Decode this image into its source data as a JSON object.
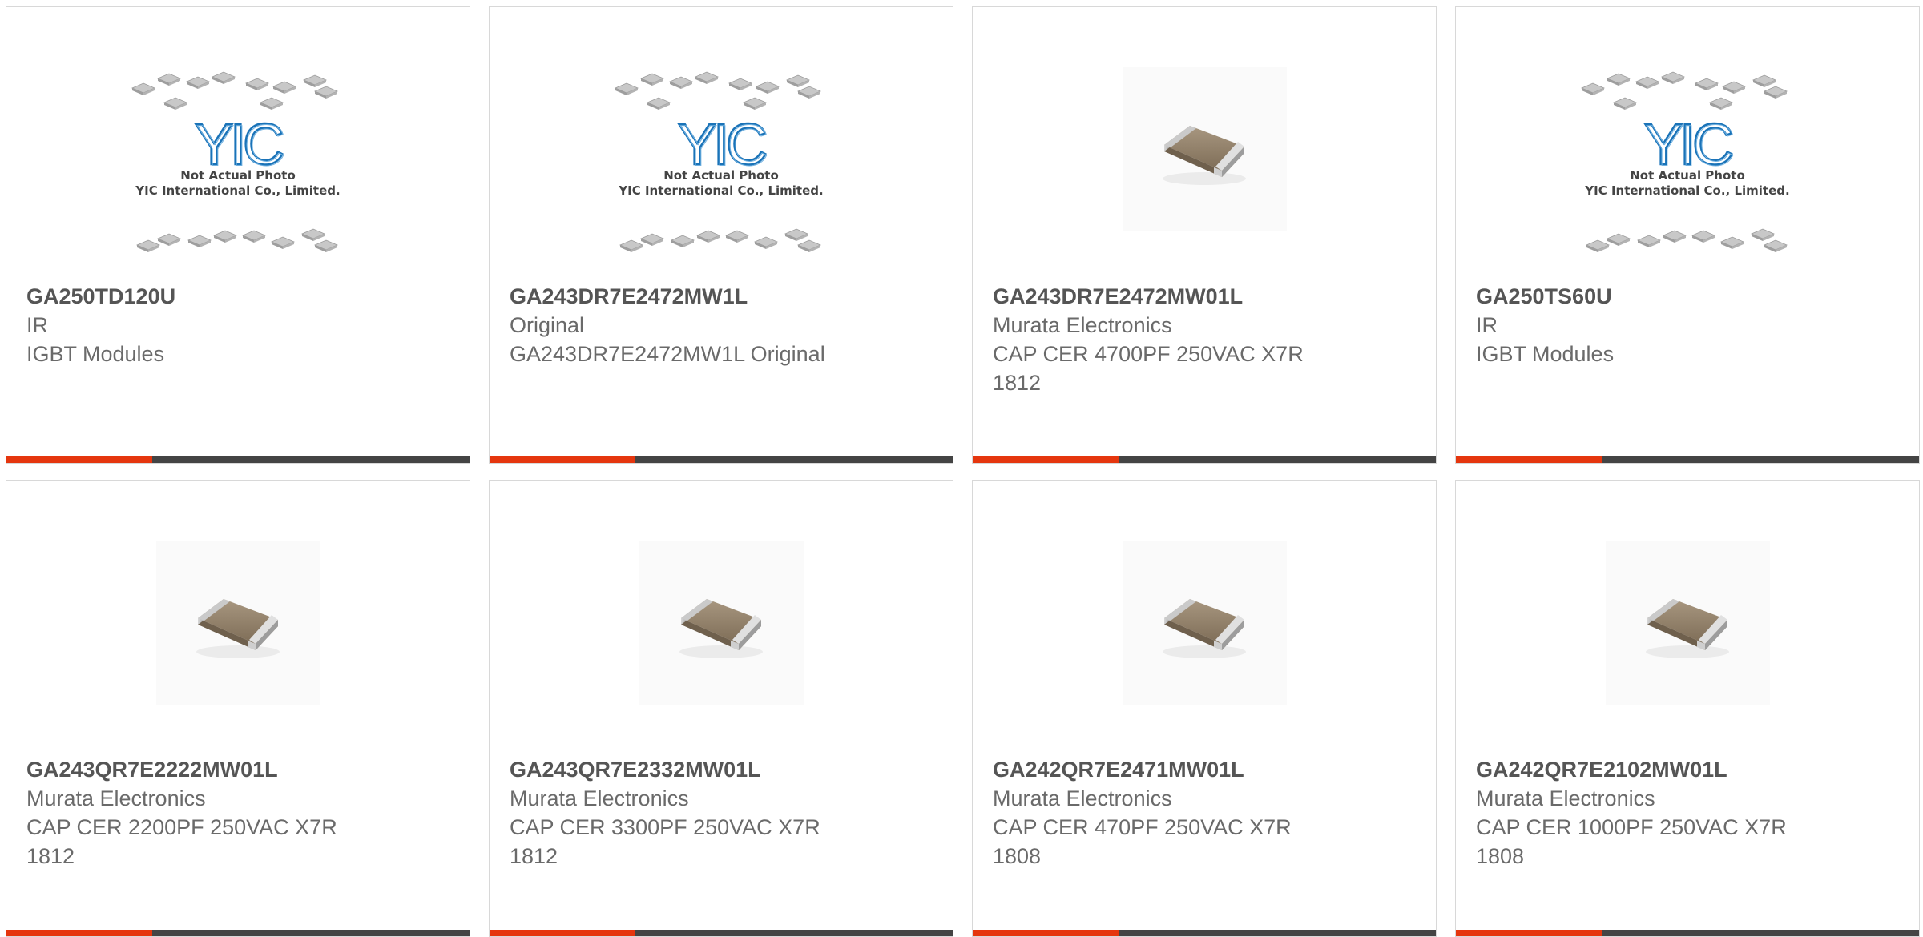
{
  "colors": {
    "accent": "#e5360e",
    "bar": "#444444",
    "border": "#d8d8d8",
    "title_text": "#555555",
    "body_text": "#6a6a6a",
    "placeholder_logo": "#1a73b8"
  },
  "placeholder": {
    "logo_text": "YIC",
    "line1": "Not Actual Photo",
    "line2": "YIC International Co., Limited."
  },
  "products": [
    {
      "part_number": "GA250TD120U",
      "manufacturer": "IR",
      "description": "IGBT Modules",
      "image": "placeholder-icon"
    },
    {
      "part_number": "GA243DR7E2472MW1L",
      "manufacturer": "Original",
      "description": "GA243DR7E2472MW1L Original",
      "image": "placeholder-icon"
    },
    {
      "part_number": "GA243DR7E2472MW01L",
      "manufacturer": "Murata Electronics",
      "description": "CAP CER 4700PF 250VAC X7R 1812",
      "image": "capacitor-icon"
    },
    {
      "part_number": "GA250TS60U",
      "manufacturer": "IR",
      "description": "IGBT Modules",
      "image": "placeholder-icon"
    },
    {
      "part_number": "GA243QR7E2222MW01L",
      "manufacturer": "Murata Electronics",
      "description": "CAP CER 2200PF 250VAC X7R 1812",
      "image": "capacitor-icon"
    },
    {
      "part_number": "GA243QR7E2332MW01L",
      "manufacturer": "Murata Electronics",
      "description": "CAP CER 3300PF 250VAC X7R 1812",
      "image": "capacitor-icon"
    },
    {
      "part_number": "GA242QR7E2471MW01L",
      "manufacturer": "Murata Electronics",
      "description": "CAP CER 470PF 250VAC X7R 1808",
      "image": "capacitor-icon"
    },
    {
      "part_number": "GA242QR7E2102MW01L",
      "manufacturer": "Murata Electronics",
      "description": "CAP CER 1000PF 250VAC X7R 1808",
      "image": "capacitor-icon"
    }
  ]
}
